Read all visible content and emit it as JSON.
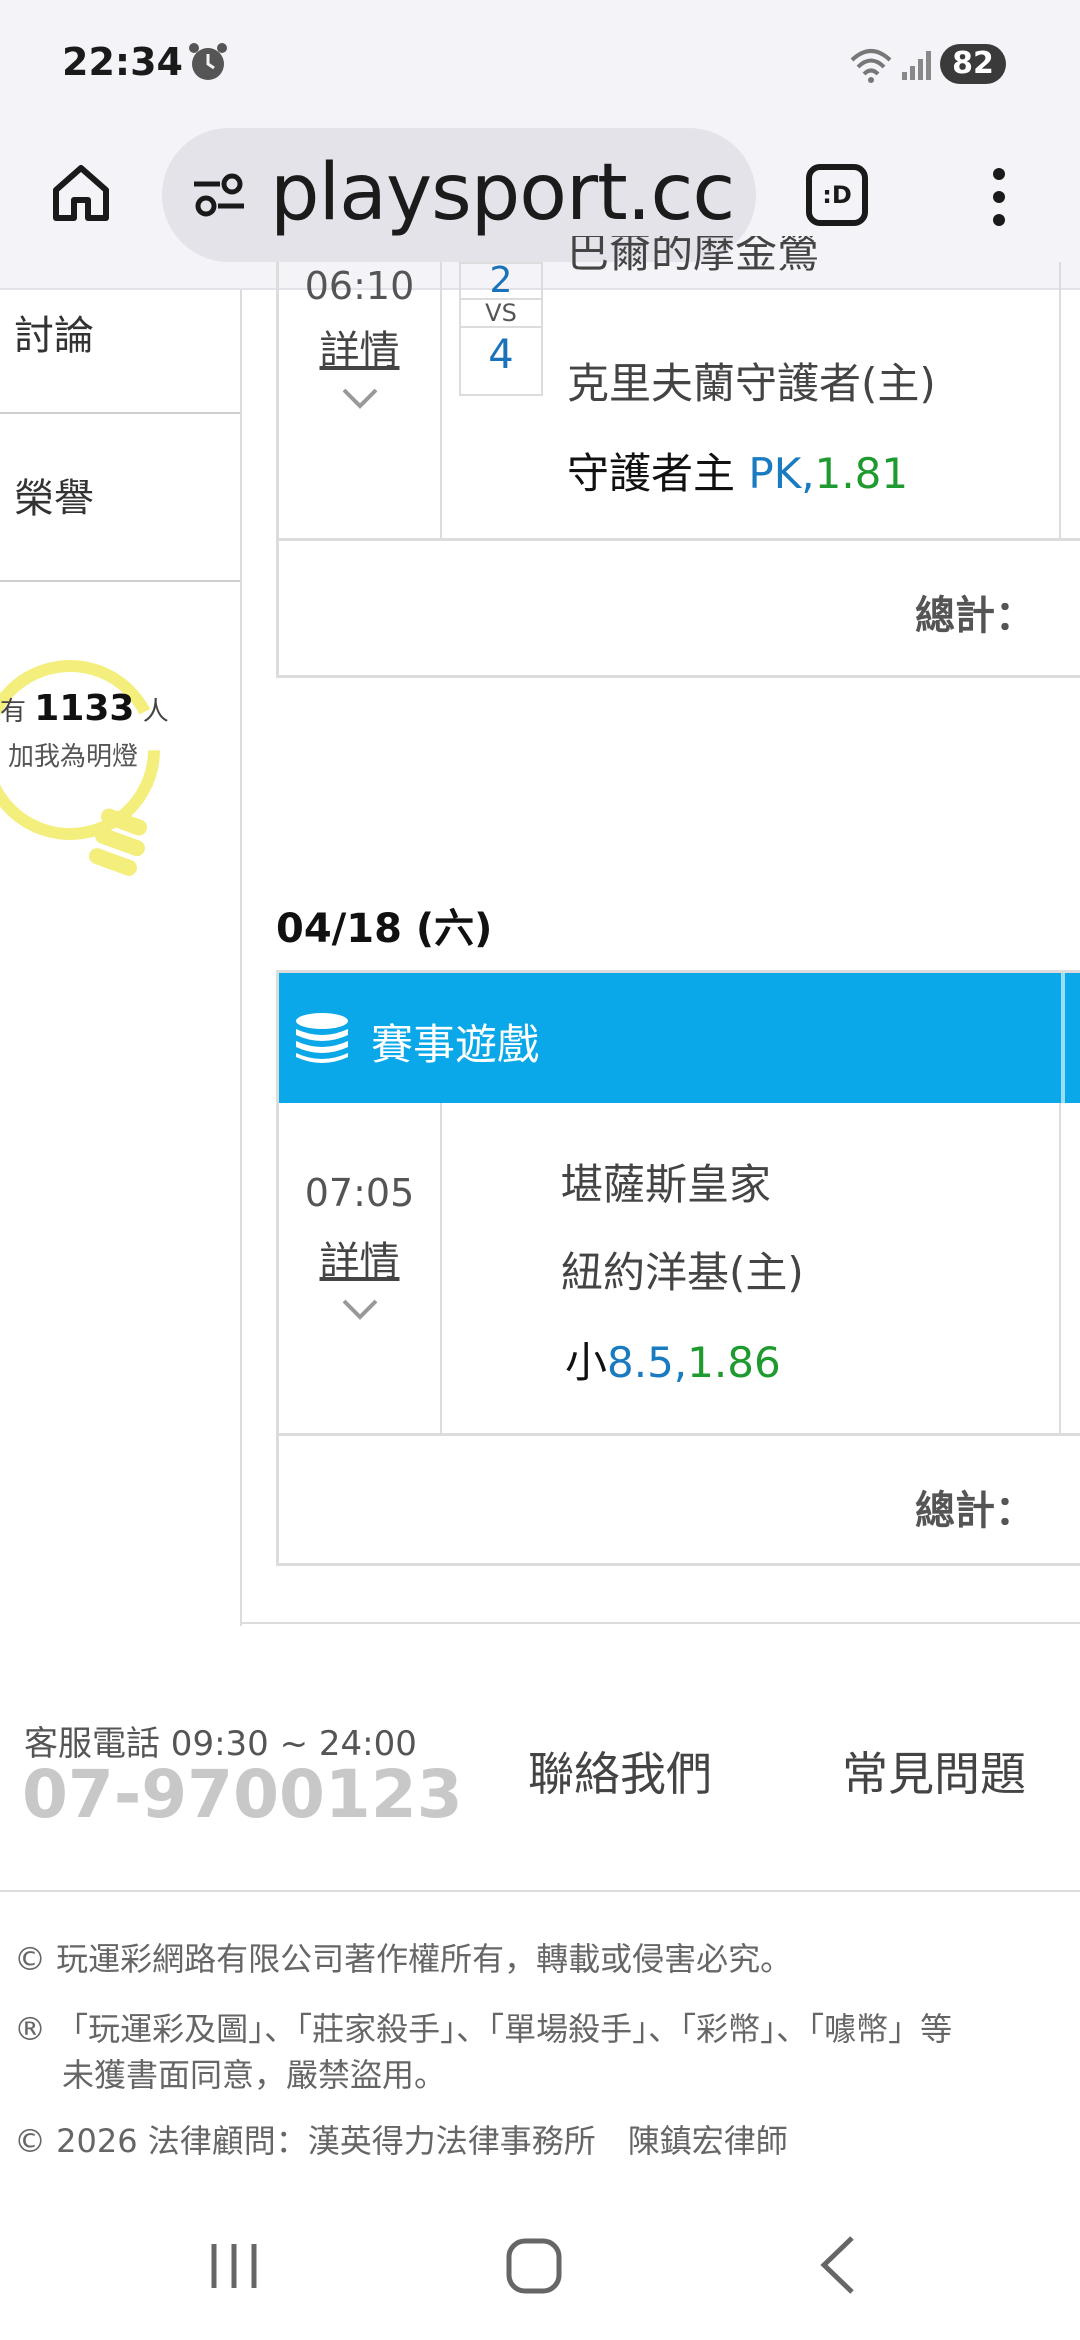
{
  "status": {
    "time": "22:34",
    "battery": "82"
  },
  "browser": {
    "url": "playsport.cc",
    "tabs_label": ":D"
  },
  "sidebar": {
    "items": [
      {
        "label": "討論"
      },
      {
        "label": "榮譽"
      }
    ],
    "lightbulb": {
      "prefix": "有",
      "count": "1133",
      "suffix": "人",
      "caption": "加我為明燈"
    }
  },
  "games": [
    {
      "time": "06:10",
      "detail_label": "詳情",
      "score_away": "2",
      "vs": "VS",
      "score_home": "4",
      "away_team": "巴爾的摩金鶯",
      "home_team": "克里夫蘭守護者(主)",
      "pick_label": "守護者主",
      "pick_line": "PK,",
      "pick_odds": "1.81",
      "total_label": "總計："
    }
  ],
  "day2": {
    "date": "04/18 (六)",
    "header": "賽事遊戲",
    "game": {
      "time": "07:05",
      "detail_label": "詳情",
      "away_team": "堪薩斯皇家",
      "home_team": "紐約洋基(主)",
      "pick_label": "小",
      "pick_line": "8.5,",
      "pick_odds": "1.86",
      "total_label": "總計："
    }
  },
  "footer": {
    "cs_label": "客服電話 09:30 ~ 24:00",
    "phone": "07-9700123",
    "contact": "聯絡我們",
    "faq": "常見問題",
    "legal1": "© 玩運彩網路有限公司著作權所有，轉載或侵害必究。",
    "legal2a": "® 「玩運彩及圖」、「莊家殺手」、「單場殺手」、「彩幣」、「噱幣」等",
    "legal2b": "未獲書面同意，嚴禁盜用。",
    "legal3": "© 2026 法律顧問：漢英得力法律事務所　陳鎮宏律師"
  },
  "colors": {
    "accent_blue": "#0aa8e8",
    "odds_blue": "#1a7bc0",
    "odds_green": "#1e9a2f"
  }
}
